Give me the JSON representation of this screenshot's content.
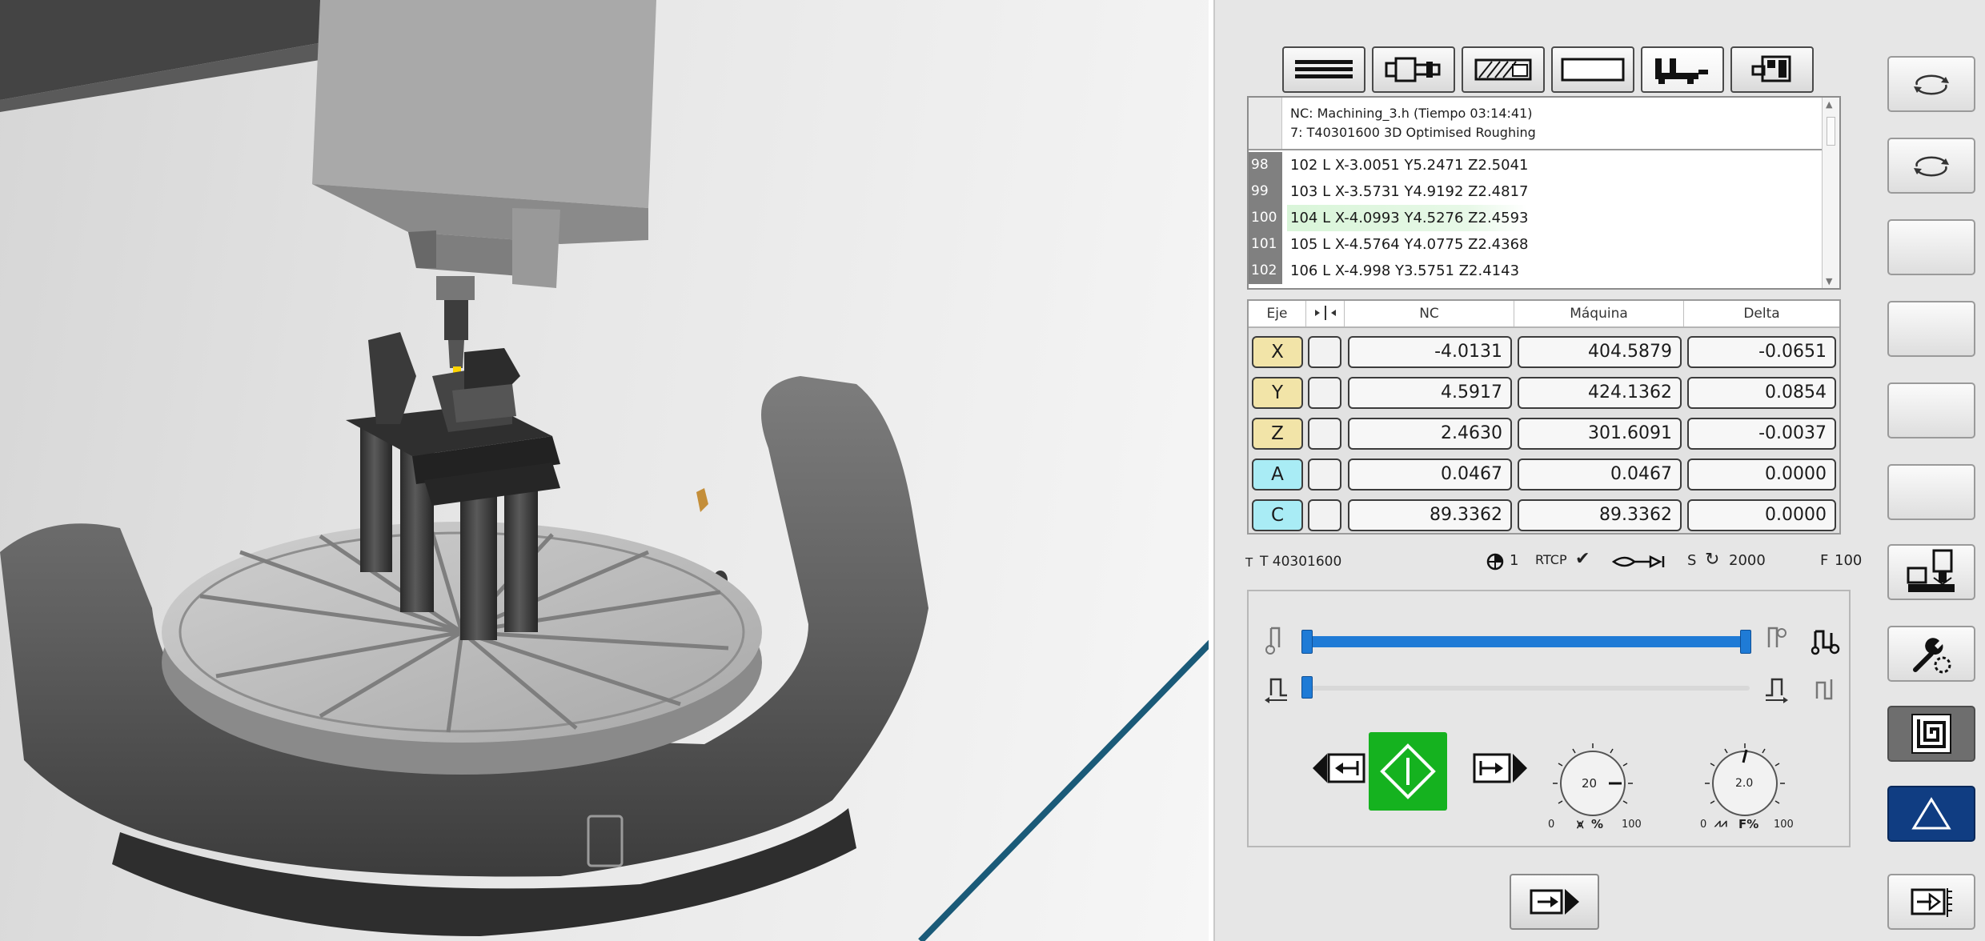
{
  "toolbar": {
    "buttons": [
      {
        "icon": "program-lines-icon"
      },
      {
        "icon": "tool-holder-icon"
      },
      {
        "icon": "hatched-part-icon"
      },
      {
        "icon": "blank-rect-icon"
      },
      {
        "icon": "machine-table-icon"
      },
      {
        "icon": "machine-cabinet-icon"
      }
    ]
  },
  "program": {
    "title": "NC: Machining_3.h (Tiempo 03:14:41)",
    "operation": "7: T40301600 3D Optimised Roughing",
    "lines": [
      {
        "num": "98",
        "code": "102 L X-3.0051 Y5.2471 Z2.5041"
      },
      {
        "num": "99",
        "code": "103 L X-3.5731 Y4.9192 Z2.4817"
      },
      {
        "num": "100",
        "code": "104 L X-4.0993 Y4.5276 Z2.4593"
      },
      {
        "num": "101",
        "code": "105 L X-4.5764 Y4.0775 Z2.4368"
      },
      {
        "num": "102",
        "code": "106 L X-4.998 Y3.5751 Z2.4143"
      }
    ],
    "current_line_index": 2
  },
  "axes": {
    "headers": {
      "axis": "Eje",
      "nc": "NC",
      "machine": "Máquina",
      "delta": "Delta"
    },
    "rows": [
      {
        "axis": "X",
        "nc": "-4.0131",
        "machine": "404.5879",
        "delta": "-0.0651",
        "color": "#f2e4a8"
      },
      {
        "axis": "Y",
        "nc": "4.5917",
        "machine": "424.1362",
        "delta": "0.0854",
        "color": "#f2e4a8"
      },
      {
        "axis": "Z",
        "nc": "2.4630",
        "machine": "301.6091",
        "delta": "-0.0037",
        "color": "#f2e4a8"
      },
      {
        "axis": "A",
        "nc": "0.0467",
        "machine": "0.0467",
        "delta": "0.0000",
        "color": "#a9ecf5"
      },
      {
        "axis": "C",
        "nc": "89.3362",
        "machine": "89.3362",
        "delta": "0.0000",
        "color": "#a9ecf5"
      }
    ]
  },
  "status": {
    "tool_prefix": "T",
    "tool": "T 40301600",
    "workoffset": "1",
    "rtcp": "RTCP",
    "spindle_prefix": "S",
    "spindle": "2000",
    "feed_prefix": "F",
    "feed": "100"
  },
  "overrides": {
    "rapid": {
      "value": "20",
      "min": "0",
      "max": "100",
      "label": "%"
    },
    "feed": {
      "value": "2.0",
      "min": "0",
      "max": "100",
      "label": "F%"
    }
  },
  "sliders": {
    "progress": 1.0,
    "block": 0.0
  },
  "colors": {
    "accent_green": "#15b21f",
    "accent_blue": "#103d82",
    "slider_blue": "#1f7bd6",
    "arrow": "#1a5a78"
  }
}
